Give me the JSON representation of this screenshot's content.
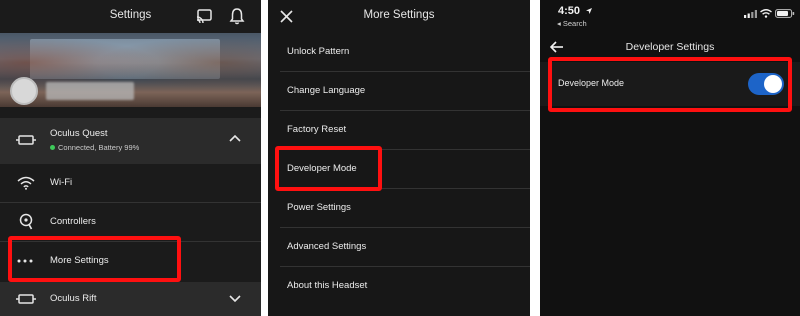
{
  "panel1": {
    "header": {
      "title": "Settings",
      "cast_icon": "cast-icon",
      "bell_icon": "bell-icon"
    },
    "device_quest": {
      "name": "Oculus Quest",
      "status": "Connected, Battery 99%",
      "icon": "headset-icon",
      "chevron": "chevron-up-icon",
      "status_color": "#3ec95a"
    },
    "items": [
      {
        "label": "Wi-Fi",
        "icon": "wifi-icon"
      },
      {
        "label": "Controllers",
        "icon": "controller-icon"
      },
      {
        "label": "More Settings",
        "icon": "more-dots-icon"
      }
    ],
    "device_rift": {
      "name": "Oculus Rift",
      "icon": "headset-icon",
      "chevron": "chevron-down-icon"
    }
  },
  "panel2": {
    "header": {
      "title": "More Settings",
      "close_icon": "close-icon"
    },
    "items": [
      "Unlock Pattern",
      "Change Language",
      "Factory Reset",
      "Developer Mode",
      "Power Settings",
      "Advanced Settings",
      "About this Headset"
    ]
  },
  "panel3": {
    "status": {
      "time": "4:50",
      "back_app": "◂ Search"
    },
    "header": {
      "title": "Developer Settings",
      "back_icon": "back-arrow-icon"
    },
    "setting": {
      "label": "Developer Mode",
      "enabled": true
    }
  },
  "colors": {
    "highlight": "#ff1010",
    "toggle": "#1d64c8"
  }
}
